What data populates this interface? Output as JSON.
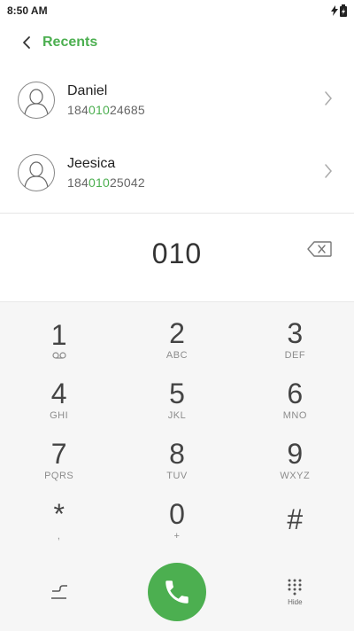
{
  "status": {
    "time": "8:50 AM"
  },
  "header": {
    "title": "Recents"
  },
  "contacts": [
    {
      "name": "Daniel",
      "number_pre": "184",
      "number_hl": "010",
      "number_post": "24685"
    },
    {
      "name": "Jeesica",
      "number_pre": "184",
      "number_hl": "010",
      "number_post": "25042"
    }
  ],
  "dialer": {
    "entered": "010",
    "keys": [
      {
        "digit": "1",
        "letters": ""
      },
      {
        "digit": "2",
        "letters": "ABC"
      },
      {
        "digit": "3",
        "letters": "DEF"
      },
      {
        "digit": "4",
        "letters": "GHI"
      },
      {
        "digit": "5",
        "letters": "JKL"
      },
      {
        "digit": "6",
        "letters": "MNO"
      },
      {
        "digit": "7",
        "letters": "PQRS"
      },
      {
        "digit": "8",
        "letters": "TUV"
      },
      {
        "digit": "9",
        "letters": "WXYZ"
      },
      {
        "digit": "*",
        "letters": ","
      },
      {
        "digit": "0",
        "letters": "+"
      },
      {
        "digit": "#",
        "letters": ""
      }
    ],
    "hide_label": "Hide"
  },
  "colors": {
    "accent": "#4caf50"
  },
  "icons": {
    "back": "back-arrow-icon",
    "avatar": "person-icon",
    "chevron": "chevron-right-icon",
    "delete": "backspace-icon",
    "voicemail": "voicemail-icon",
    "call": "phone-icon",
    "switch": "switch-icon",
    "keypad": "dialpad-icon"
  }
}
